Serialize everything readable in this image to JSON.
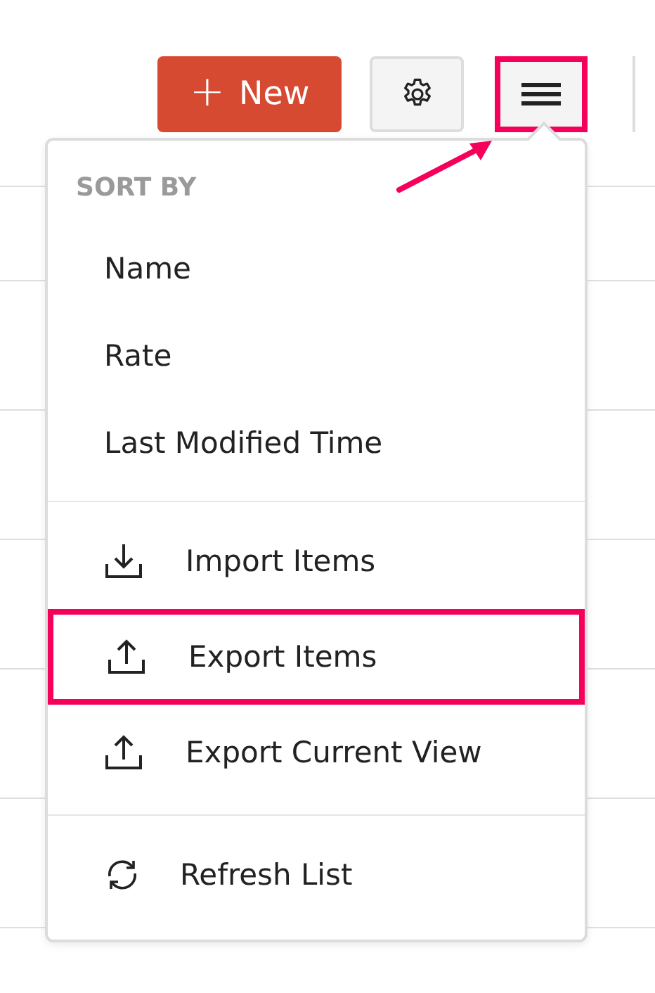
{
  "toolbar": {
    "new_button": {
      "icon": "+",
      "label": "New"
    },
    "settings_button": {
      "highlighted": false
    },
    "menu_button": {
      "highlighted": true
    }
  },
  "menu": {
    "section_title": "SORT BY",
    "groups": [
      {
        "items": [
          {
            "kind": "plain",
            "label": "Name",
            "highlighted": false
          },
          {
            "kind": "plain",
            "label": "Rate",
            "highlighted": false
          },
          {
            "kind": "plain",
            "label": "Last Modified Time",
            "highlighted": false
          }
        ]
      },
      {
        "items": [
          {
            "kind": "download",
            "label": "Import Items",
            "highlighted": false
          },
          {
            "kind": "upload",
            "label": "Export Items",
            "highlighted": true
          },
          {
            "kind": "upload",
            "label": "Export Current View",
            "highlighted": false
          }
        ]
      },
      {
        "items": [
          {
            "kind": "refresh",
            "label": "Refresh List",
            "highlighted": false
          }
        ]
      }
    ]
  }
}
